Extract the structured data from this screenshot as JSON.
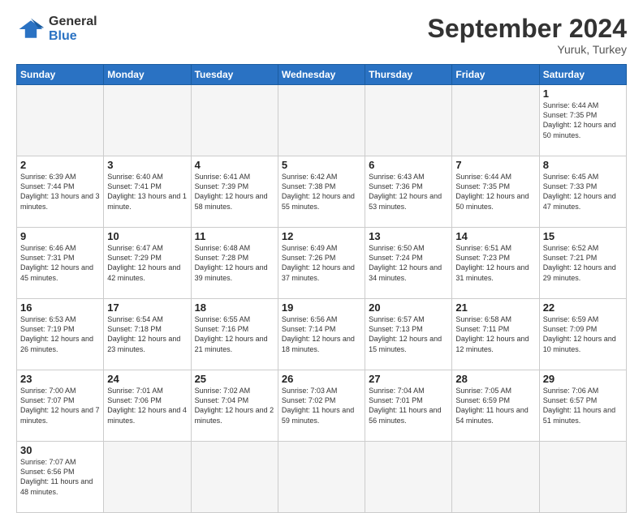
{
  "logo": {
    "line1": "General",
    "line2": "Blue"
  },
  "title": "September 2024",
  "subtitle": "Yuruk, Turkey",
  "weekdays": [
    "Sunday",
    "Monday",
    "Tuesday",
    "Wednesday",
    "Thursday",
    "Friday",
    "Saturday"
  ],
  "days": [
    {
      "day": "",
      "empty": true
    },
    {
      "day": "",
      "empty": true
    },
    {
      "day": "",
      "empty": true
    },
    {
      "day": "",
      "empty": true
    },
    {
      "day": "",
      "empty": true
    },
    {
      "day": "",
      "empty": true
    },
    {
      "day": "1",
      "sunrise": "6:44 AM",
      "sunset": "7:35 PM",
      "daylight": "12 hours and 50 minutes."
    },
    {
      "day": "2",
      "sunrise": "6:39 AM",
      "sunset": "7:44 PM",
      "daylight": "13 hours and 3 minutes."
    },
    {
      "day": "3",
      "sunrise": "6:40 AM",
      "sunset": "7:41 PM",
      "daylight": "13 hours and 1 minute."
    },
    {
      "day": "4",
      "sunrise": "6:41 AM",
      "sunset": "7:39 PM",
      "daylight": "12 hours and 58 minutes."
    },
    {
      "day": "5",
      "sunrise": "6:42 AM",
      "sunset": "7:38 PM",
      "daylight": "12 hours and 55 minutes."
    },
    {
      "day": "6",
      "sunrise": "6:43 AM",
      "sunset": "7:36 PM",
      "daylight": "12 hours and 53 minutes."
    },
    {
      "day": "7",
      "sunrise": "6:44 AM",
      "sunset": "7:35 PM",
      "daylight": "12 hours and 50 minutes."
    },
    {
      "day": "8",
      "sunrise": "6:45 AM",
      "sunset": "7:33 PM",
      "daylight": "12 hours and 47 minutes."
    },
    {
      "day": "9",
      "sunrise": "6:46 AM",
      "sunset": "7:31 PM",
      "daylight": "12 hours and 45 minutes."
    },
    {
      "day": "10",
      "sunrise": "6:47 AM",
      "sunset": "7:29 PM",
      "daylight": "12 hours and 42 minutes."
    },
    {
      "day": "11",
      "sunrise": "6:48 AM",
      "sunset": "7:28 PM",
      "daylight": "12 hours and 39 minutes."
    },
    {
      "day": "12",
      "sunrise": "6:49 AM",
      "sunset": "7:26 PM",
      "daylight": "12 hours and 37 minutes."
    },
    {
      "day": "13",
      "sunrise": "6:50 AM",
      "sunset": "7:24 PM",
      "daylight": "12 hours and 34 minutes."
    },
    {
      "day": "14",
      "sunrise": "6:51 AM",
      "sunset": "7:23 PM",
      "daylight": "12 hours and 31 minutes."
    },
    {
      "day": "15",
      "sunrise": "6:52 AM",
      "sunset": "7:21 PM",
      "daylight": "12 hours and 29 minutes."
    },
    {
      "day": "16",
      "sunrise": "6:53 AM",
      "sunset": "7:19 PM",
      "daylight": "12 hours and 26 minutes."
    },
    {
      "day": "17",
      "sunrise": "6:54 AM",
      "sunset": "7:18 PM",
      "daylight": "12 hours and 23 minutes."
    },
    {
      "day": "18",
      "sunrise": "6:55 AM",
      "sunset": "7:16 PM",
      "daylight": "12 hours and 21 minutes."
    },
    {
      "day": "19",
      "sunrise": "6:56 AM",
      "sunset": "7:14 PM",
      "daylight": "12 hours and 18 minutes."
    },
    {
      "day": "20",
      "sunrise": "6:57 AM",
      "sunset": "7:13 PM",
      "daylight": "12 hours and 15 minutes."
    },
    {
      "day": "21",
      "sunrise": "6:58 AM",
      "sunset": "7:11 PM",
      "daylight": "12 hours and 12 minutes."
    },
    {
      "day": "22",
      "sunrise": "6:59 AM",
      "sunset": "7:09 PM",
      "daylight": "12 hours and 10 minutes."
    },
    {
      "day": "23",
      "sunrise": "7:00 AM",
      "sunset": "7:07 PM",
      "daylight": "12 hours and 7 minutes."
    },
    {
      "day": "24",
      "sunrise": "7:01 AM",
      "sunset": "7:06 PM",
      "daylight": "12 hours and 4 minutes."
    },
    {
      "day": "25",
      "sunrise": "7:02 AM",
      "sunset": "7:04 PM",
      "daylight": "12 hours and 2 minutes."
    },
    {
      "day": "26",
      "sunrise": "7:03 AM",
      "sunset": "7:02 PM",
      "daylight": "11 hours and 59 minutes."
    },
    {
      "day": "27",
      "sunrise": "7:04 AM",
      "sunset": "7:01 PM",
      "daylight": "11 hours and 56 minutes."
    },
    {
      "day": "28",
      "sunrise": "7:05 AM",
      "sunset": "6:59 PM",
      "daylight": "11 hours and 54 minutes."
    },
    {
      "day": "29",
      "sunrise": "7:06 AM",
      "sunset": "6:57 PM",
      "daylight": "11 hours and 51 minutes."
    },
    {
      "day": "30",
      "sunrise": "7:07 AM",
      "sunset": "6:56 PM",
      "daylight": "11 hours and 48 minutes."
    },
    {
      "day": "",
      "empty": true
    },
    {
      "day": "",
      "empty": true
    },
    {
      "day": "",
      "empty": true
    },
    {
      "day": "",
      "empty": true
    },
    {
      "day": "",
      "empty": true
    }
  ]
}
